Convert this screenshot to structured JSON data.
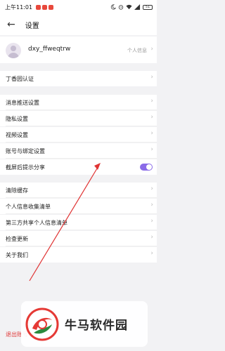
{
  "status_bar": {
    "time": "上午11:01",
    "battery": "51",
    "notification_colors": [
      "#e8483c",
      "#e8483c",
      "#e8483c"
    ]
  },
  "header": {
    "title": "设置",
    "back_icon": "arrow-left-icon"
  },
  "profile": {
    "username": "dxy_ffweqtrw",
    "info_link": "个人信息"
  },
  "settings": {
    "items": [
      {
        "label": "丁香园认证"
      },
      {
        "label": "消息推送设置"
      },
      {
        "label": "隐私设置"
      },
      {
        "label": "视频设置"
      },
      {
        "label": "账号与绑定设置"
      },
      {
        "label": "截屏后提示分享",
        "toggle": true,
        "toggle_on": true
      },
      {
        "label": "清除缓存"
      },
      {
        "label": "个人信息收集清单"
      },
      {
        "label": "第三方共享个人信息清单"
      },
      {
        "label": "检查更新"
      },
      {
        "label": "关于我们"
      }
    ]
  },
  "logout_label": "退出账号",
  "colors": {
    "accent": "#8a6be8",
    "annotation": "#e03434",
    "logout": "#e03a3a"
  },
  "watermark": {
    "text": "牛马软件园"
  }
}
